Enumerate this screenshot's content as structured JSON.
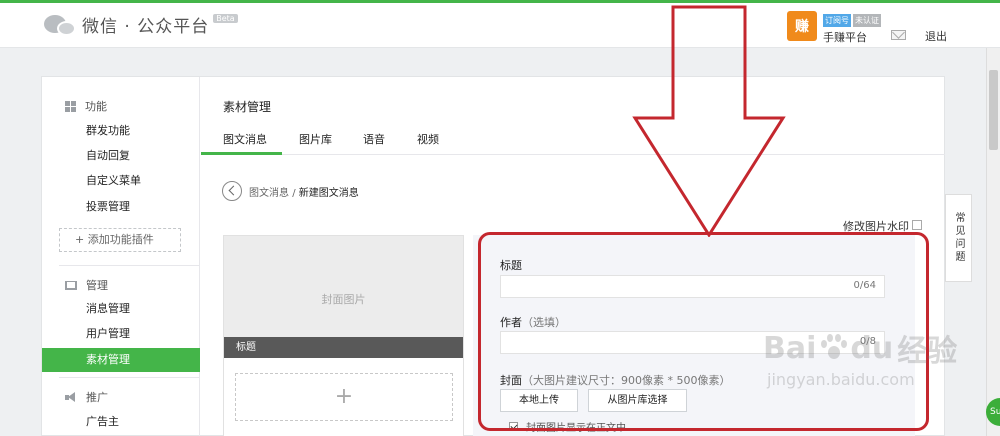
{
  "header": {
    "logo_text": "微信 · 公众平台",
    "beta_label": "Beta",
    "account": {
      "avatar_text": "赚",
      "type_tag": "订阅号",
      "verify_tag": "未认证",
      "name": "手赚平台"
    },
    "logout_label": "退出"
  },
  "sidebar": {
    "function_section": {
      "title": "功能",
      "items": [
        "群发功能",
        "自动回复",
        "自定义菜单",
        "投票管理"
      ],
      "add_plugin": "+ 添加功能插件"
    },
    "manage_section": {
      "title": "管理",
      "items": [
        "消息管理",
        "用户管理",
        "素材管理"
      ],
      "active_item": "素材管理"
    },
    "promote_section": {
      "title": "推广",
      "items": [
        "广告主"
      ]
    }
  },
  "main": {
    "title": "素材管理",
    "tabs": [
      "图文消息",
      "图片库",
      "语音",
      "视频"
    ],
    "active_tab": "图文消息",
    "breadcrumb": {
      "parent": "图文消息",
      "separator": "/",
      "current": "新建图文消息"
    },
    "watermark_label": "修改图片水印",
    "preview": {
      "cover_text": "封面图片",
      "title_text": "标题",
      "add_symbol": "+"
    },
    "editor": {
      "title_label": "标题",
      "title_count": "0/64",
      "author_label": "作者",
      "author_hint": "（选填）",
      "author_count": "0/8",
      "cover_label": "封面",
      "cover_hint": "（大图片建议尺寸：900像素 * 500像素）",
      "upload_button": "本地上传",
      "library_button": "从图片库选择",
      "show_cover_label": "封面图片显示在正文中",
      "show_cover_checked": true
    }
  },
  "faq_label": "常见问题",
  "watermark": {
    "brand_a": "Bai",
    "brand_b": "du",
    "brand_cn": "经验",
    "url": "jingyan.baidu.com"
  },
  "badge_text": "Su",
  "colors": {
    "accent_green": "#44b549",
    "annotation_red": "#c4272e",
    "avatar_orange": "#f08a1b",
    "tag_blue": "#52a8e8"
  }
}
